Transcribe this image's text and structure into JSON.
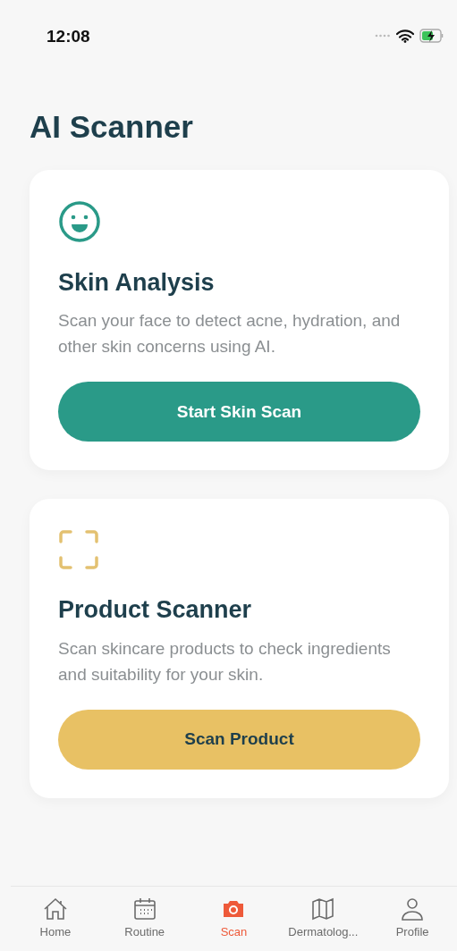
{
  "status_bar": {
    "time": "12:08"
  },
  "title": "AI Scanner",
  "cards": [
    {
      "kind": "skin",
      "title": "Skin Analysis",
      "description": "Scan your face to detect acne, hydration, and other skin concerns using AI.",
      "button": "Start Skin Scan"
    },
    {
      "kind": "product",
      "title": "Product Scanner",
      "description": "Scan skincare products to check ingredients and suitability for your skin.",
      "button": "Scan Product"
    }
  ],
  "tab_bar": [
    {
      "kind": "home",
      "label": "Home",
      "selected": false
    },
    {
      "kind": "calendar",
      "label": "Routine",
      "selected": false
    },
    {
      "kind": "camera",
      "label": "Scan",
      "selected": true
    },
    {
      "kind": "map",
      "label": "Dermatolog...",
      "selected": false
    },
    {
      "kind": "person",
      "label": "Profile",
      "selected": false
    }
  ]
}
